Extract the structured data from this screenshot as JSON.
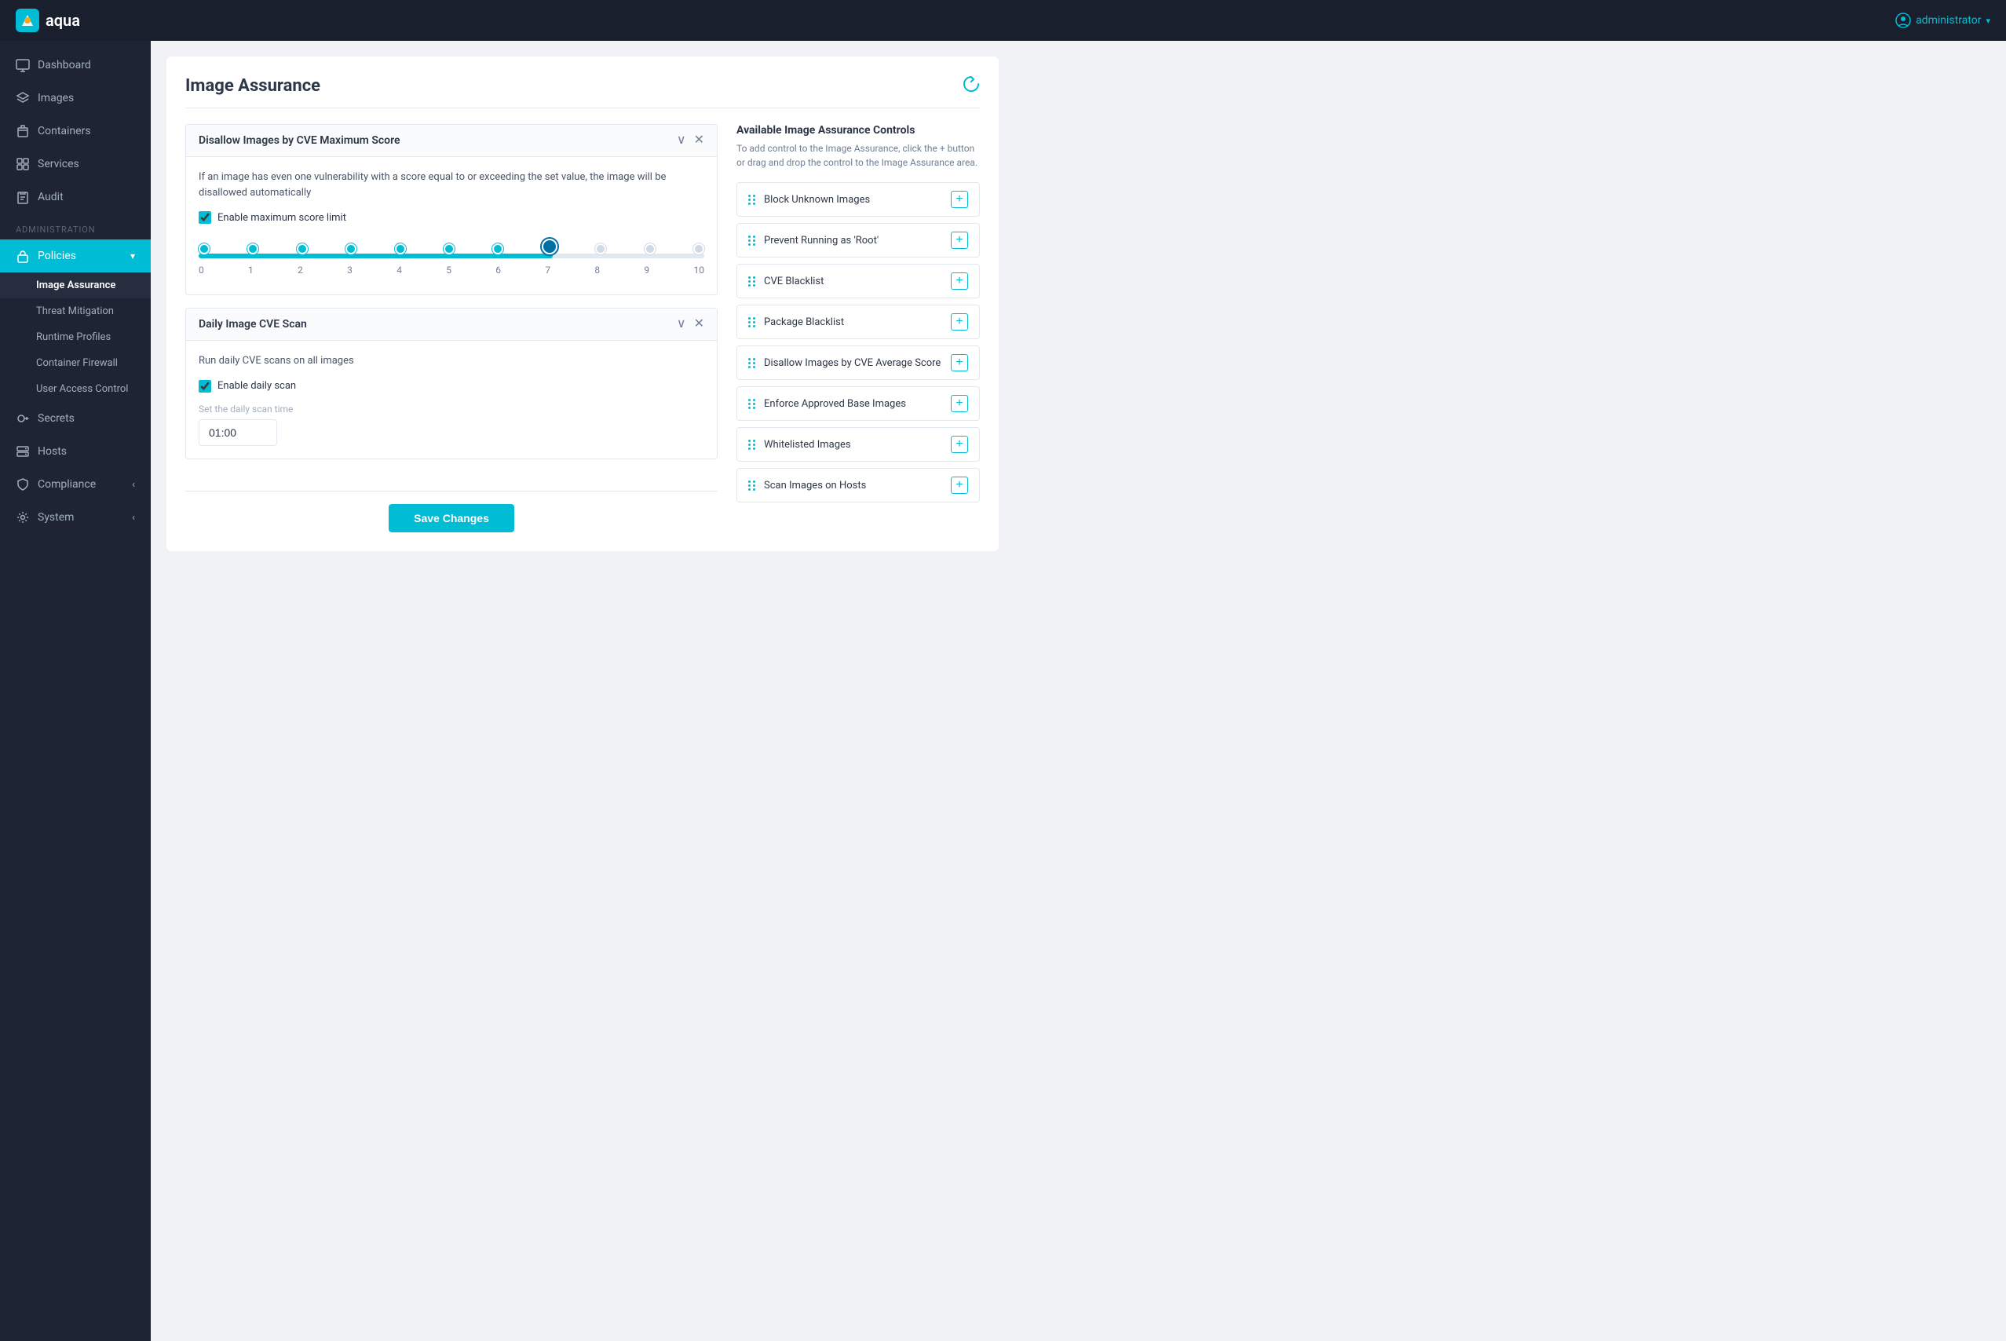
{
  "app": {
    "name": "aqua",
    "logo_text": "aqua"
  },
  "topnav": {
    "user_label": "administrator",
    "user_dropdown": "▾"
  },
  "sidebar": {
    "nav_items": [
      {
        "id": "dashboard",
        "label": "Dashboard",
        "icon": "monitor"
      },
      {
        "id": "images",
        "label": "Images",
        "icon": "layers"
      },
      {
        "id": "containers",
        "label": "Containers",
        "icon": "box"
      },
      {
        "id": "services",
        "label": "Services",
        "icon": "grid"
      },
      {
        "id": "audit",
        "label": "Audit",
        "icon": "clipboard"
      }
    ],
    "admin_section_label": "Administration",
    "policies_label": "Policies",
    "policies_chevron": "▾",
    "submenu": [
      {
        "id": "image-assurance",
        "label": "Image Assurance",
        "active": true
      },
      {
        "id": "threat-mitigation",
        "label": "Threat Mitigation"
      },
      {
        "id": "runtime-profiles",
        "label": "Runtime Profiles"
      },
      {
        "id": "container-firewall",
        "label": "Container Firewall"
      },
      {
        "id": "user-access-control",
        "label": "User Access Control"
      }
    ],
    "other_items": [
      {
        "id": "secrets",
        "label": "Secrets",
        "icon": "key"
      },
      {
        "id": "hosts",
        "label": "Hosts",
        "icon": "server"
      },
      {
        "id": "compliance",
        "label": "Compliance",
        "icon": "shield",
        "arrow": "‹"
      },
      {
        "id": "system",
        "label": "System",
        "icon": "settings",
        "arrow": "‹"
      }
    ]
  },
  "page": {
    "title": "Image Assurance",
    "refresh_tooltip": "Refresh"
  },
  "cve_card": {
    "title": "Disallow Images by CVE Maximum Score",
    "description": "If an image has even one vulnerability with a score equal to or exceeding the set value, the image will be disallowed automatically",
    "checkbox_label": "Enable maximum score limit",
    "checkbox_checked": true,
    "slider_value": 7,
    "slider_min": 0,
    "slider_max": 10,
    "slider_labels": [
      "0",
      "1",
      "2",
      "3",
      "4",
      "5",
      "6",
      "7",
      "8",
      "9",
      "10"
    ]
  },
  "daily_scan_card": {
    "title": "Daily Image CVE Scan",
    "description": "Run daily CVE scans on all images",
    "checkbox_label": "Enable daily scan",
    "checkbox_checked": true,
    "time_field_label": "Set the daily scan time",
    "time_value": "01:00"
  },
  "controls_panel": {
    "title": "Available Image Assurance Controls",
    "description": "To add control to the Image Assurance, click the + button or drag and drop the control to the Image Assurance area.",
    "controls": [
      {
        "id": "block-unknown-images",
        "label": "Block Unknown Images"
      },
      {
        "id": "prevent-running-root",
        "label": "Prevent Running as 'Root'"
      },
      {
        "id": "cve-blacklist",
        "label": "CVE Blacklist"
      },
      {
        "id": "package-blacklist",
        "label": "Package Blacklist"
      },
      {
        "id": "disallow-cve-average",
        "label": "Disallow Images by CVE Average Score"
      },
      {
        "id": "enforce-base-images",
        "label": "Enforce Approved Base Images"
      },
      {
        "id": "whitelisted-images",
        "label": "Whitelisted Images"
      },
      {
        "id": "scan-images-hosts",
        "label": "Scan Images on Hosts"
      }
    ]
  },
  "footer": {
    "save_label": "Save Changes"
  }
}
